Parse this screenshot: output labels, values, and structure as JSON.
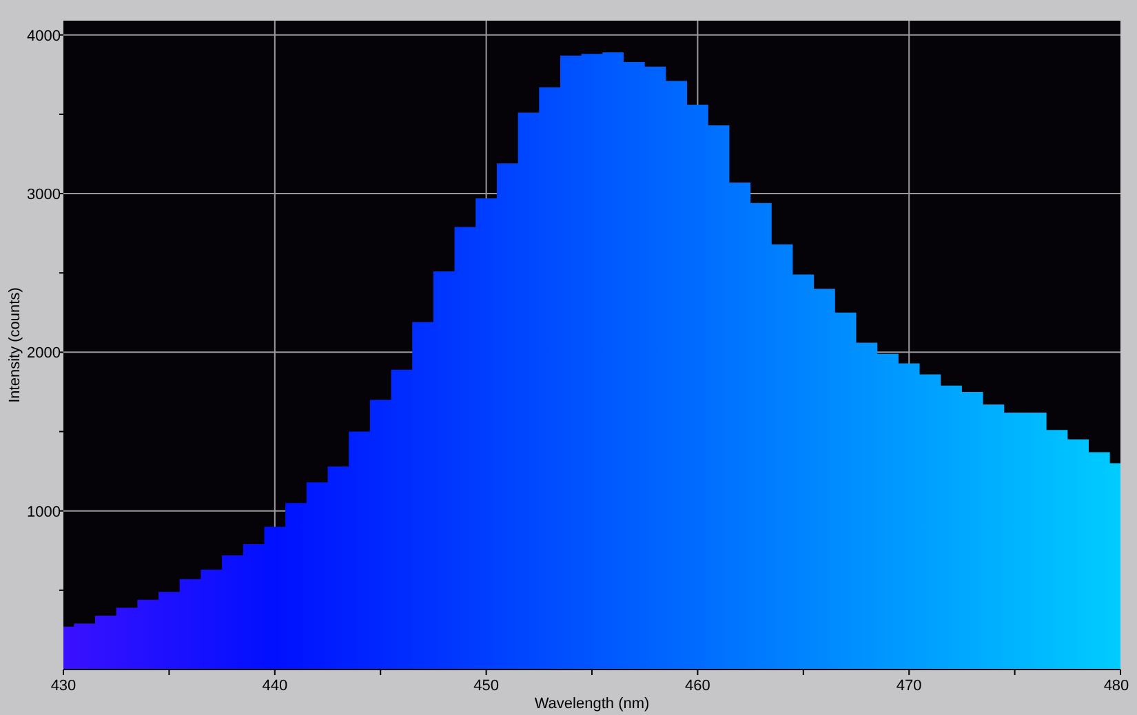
{
  "chart_data": {
    "type": "area",
    "xlabel": "Wavelength (nm)",
    "ylabel": "Intensity (counts)",
    "x": [
      430,
      431,
      432,
      433,
      434,
      435,
      436,
      437,
      438,
      439,
      440,
      441,
      442,
      443,
      444,
      445,
      446,
      447,
      448,
      449,
      450,
      451,
      452,
      453,
      454,
      455,
      456,
      457,
      458,
      459,
      460,
      461,
      462,
      463,
      464,
      465,
      466,
      467,
      468,
      469,
      470,
      471,
      472,
      473,
      474,
      475,
      476,
      477,
      478,
      479,
      480
    ],
    "grid": true,
    "series": [
      {
        "values": [
          270,
          290,
          340,
          390,
          440,
          490,
          570,
          630,
          720,
          790,
          900,
          1050,
          1180,
          1280,
          1500,
          1700,
          1890,
          2190,
          2510,
          2790,
          2970,
          3190,
          3510,
          3670,
          3870,
          3880,
          3890,
          3830,
          3800,
          3710,
          3560,
          3430,
          3070,
          2940,
          2680,
          2490,
          2400,
          2250,
          2060,
          1990,
          1930,
          1860,
          1790,
          1750,
          1670,
          1620,
          1620,
          1510,
          1450,
          1370,
          1300
        ]
      }
    ],
    "xlim": [
      430,
      480
    ],
    "ylim": [
      0,
      4090
    ],
    "xticks": [
      430,
      440,
      450,
      460,
      470,
      480
    ],
    "yticks": [
      1000,
      2000,
      3000,
      4000
    ]
  }
}
